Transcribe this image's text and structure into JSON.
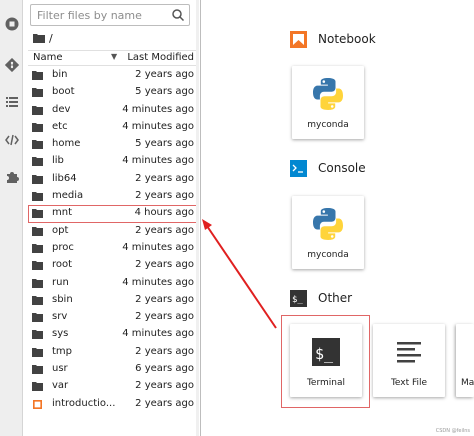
{
  "sidebar": {
    "icons": [
      "running-icon",
      "git-icon",
      "toc-icon",
      "code-icon",
      "extension-icon"
    ]
  },
  "filebrowser": {
    "search_placeholder": "Filter files by name",
    "path": "/",
    "columns": {
      "name": "Name",
      "modified": "Last Modified"
    },
    "files": [
      {
        "name": "bin",
        "modified": "2 years ago",
        "kind": "folder"
      },
      {
        "name": "boot",
        "modified": "5 years ago",
        "kind": "folder"
      },
      {
        "name": "dev",
        "modified": "4 minutes ago",
        "kind": "folder"
      },
      {
        "name": "etc",
        "modified": "4 minutes ago",
        "kind": "folder"
      },
      {
        "name": "home",
        "modified": "5 years ago",
        "kind": "folder"
      },
      {
        "name": "lib",
        "modified": "4 minutes ago",
        "kind": "folder"
      },
      {
        "name": "lib64",
        "modified": "2 years ago",
        "kind": "folder"
      },
      {
        "name": "media",
        "modified": "2 years ago",
        "kind": "folder"
      },
      {
        "name": "mnt",
        "modified": "4 hours ago",
        "kind": "folder"
      },
      {
        "name": "opt",
        "modified": "2 years ago",
        "kind": "folder"
      },
      {
        "name": "proc",
        "modified": "4 minutes ago",
        "kind": "folder"
      },
      {
        "name": "root",
        "modified": "2 years ago",
        "kind": "folder"
      },
      {
        "name": "run",
        "modified": "4 minutes ago",
        "kind": "folder"
      },
      {
        "name": "sbin",
        "modified": "2 years ago",
        "kind": "folder"
      },
      {
        "name": "srv",
        "modified": "2 years ago",
        "kind": "folder"
      },
      {
        "name": "sys",
        "modified": "4 minutes ago",
        "kind": "folder"
      },
      {
        "name": "tmp",
        "modified": "2 years ago",
        "kind": "folder"
      },
      {
        "name": "usr",
        "modified": "6 years ago",
        "kind": "folder"
      },
      {
        "name": "var",
        "modified": "2 years ago",
        "kind": "folder"
      },
      {
        "name": "introductio...",
        "modified": "2 years ago",
        "kind": "notebook"
      }
    ],
    "highlighted_row": "mnt"
  },
  "launcher": {
    "sections": [
      {
        "title": "Notebook",
        "icon": "notebook-icon"
      },
      {
        "title": "Console",
        "icon": "console-icon"
      },
      {
        "title": "Other",
        "icon": "terminal-icon"
      }
    ],
    "notebook_card": "myconda",
    "console_card": "myconda",
    "other_cards": [
      "Terminal",
      "Text File",
      "Ma"
    ],
    "highlighted_card": "Terminal",
    "watermark": "CSDN @feilns"
  },
  "colors": {
    "highlight": "#e06666",
    "arrow": "#e02020",
    "notebook_orange": "#f37626",
    "console_blue": "#0288d1",
    "terminal_dark": "#333333"
  }
}
